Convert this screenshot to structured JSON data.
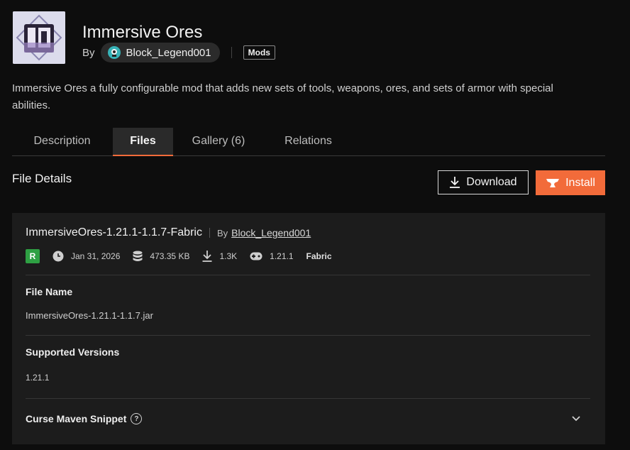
{
  "project": {
    "title": "Immersive Ores",
    "by_label": "By",
    "author": "Block_Legend001",
    "category": "Mods",
    "summary": "Immersive Ores a fully configurable mod that adds new sets of tools, weapons, ores, and sets of armor with special abilities."
  },
  "tabs": [
    {
      "label": "Description",
      "active": false
    },
    {
      "label": "Files",
      "active": true
    },
    {
      "label": "Gallery (6)",
      "active": false
    },
    {
      "label": "Relations",
      "active": false
    }
  ],
  "file_details": {
    "section_title": "File Details",
    "download_label": "Download",
    "install_label": "Install",
    "file": {
      "display_name": "ImmersiveOres-1.21.1-1.1.7-Fabric",
      "by_label": "By",
      "author": "Block_Legend001",
      "release_type": "R",
      "date": "Jan 31, 2026",
      "size": "473.35 KB",
      "downloads": "1.3K",
      "game_version": "1.21.1",
      "loader": "Fabric"
    },
    "file_name_label": "File Name",
    "file_name": "ImmersiveOres-1.21.1-1.1.7.jar",
    "supported_versions_label": "Supported Versions",
    "supported_versions": "1.21.1",
    "maven_label": "Curse Maven Snippet",
    "help_glyph": "?"
  },
  "colors": {
    "accent": "#f26b3a",
    "release_green": "#2ea043",
    "background": "#0d0d0d",
    "panel": "#1c1c1c"
  },
  "icons": [
    "project-logo-icon",
    "author-avatar-icon",
    "download-icon",
    "anvil-icon",
    "clock-icon",
    "database-icon",
    "download-count-icon",
    "gamepad-icon",
    "help-icon",
    "chevron-down-icon"
  ]
}
